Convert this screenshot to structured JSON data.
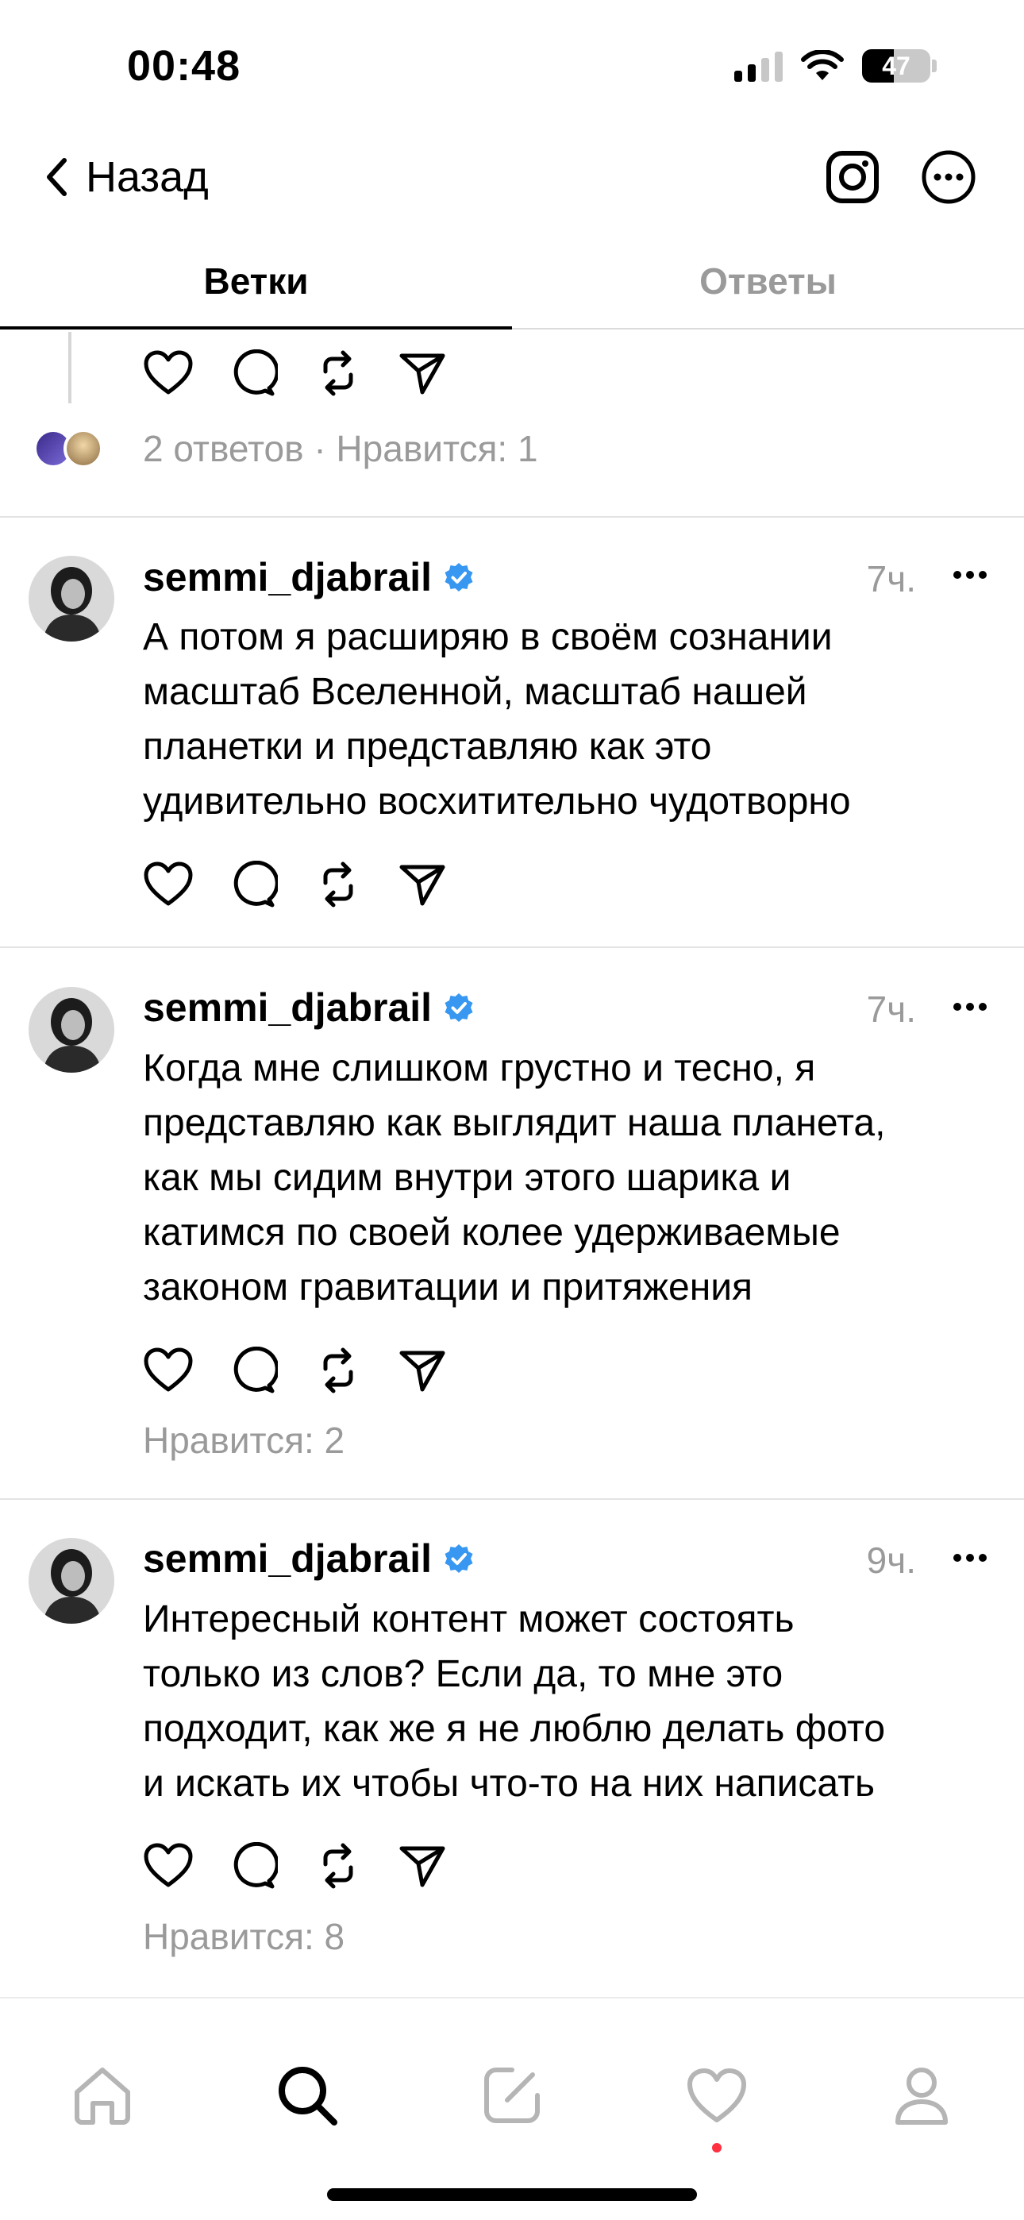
{
  "status": {
    "time": "00:48",
    "battery": "47",
    "battery_level": 0.47
  },
  "nav": {
    "back_label": "Назад",
    "icons": [
      "chevron-left-icon",
      "instagram-icon",
      "more-circle-icon"
    ]
  },
  "tabs": [
    {
      "label": "Ветки",
      "active": true
    },
    {
      "label": "Ответы",
      "active": false
    }
  ],
  "top_post": {
    "meta": "2 ответов · Нравится: 1"
  },
  "posts": [
    {
      "username": "semmi_djabrail",
      "verified": true,
      "time": "7ч.",
      "text_lines": [
        "А потом я расширяю в своём сознании",
        "масштаб Вселенной, масштаб нашей",
        "планетки и представляю как это",
        "удивительно восхитительно чудотворно"
      ],
      "likes": ""
    },
    {
      "username": "semmi_djabrail",
      "verified": true,
      "time": "7ч.",
      "text_lines": [
        "Когда мне слишком грустно и тесно, я",
        "представляю как выглядит наша планета,",
        "как мы сидим внутри этого шарика и",
        "катимся по своей колее удерживаемые",
        "законом гравитации и притяжения"
      ],
      "likes": "Нравится: 2"
    },
    {
      "username": "semmi_djabrail",
      "verified": true,
      "time": "9ч.",
      "text_lines": [
        "Интересный контент может состоять",
        "только из слов? Если да, то мне это",
        "подходит, как же я не люблю делать фото",
        "и искать их чтобы что-то на них написать"
      ],
      "likes": "Нравится: 8"
    }
  ],
  "bottom_nav": [
    "home-icon",
    "search-icon",
    "compose-icon",
    "heart-icon",
    "profile-icon"
  ],
  "colors": {
    "verified": "#3897f0",
    "muted": "#9a9a9a",
    "notification": "#ff3040"
  }
}
